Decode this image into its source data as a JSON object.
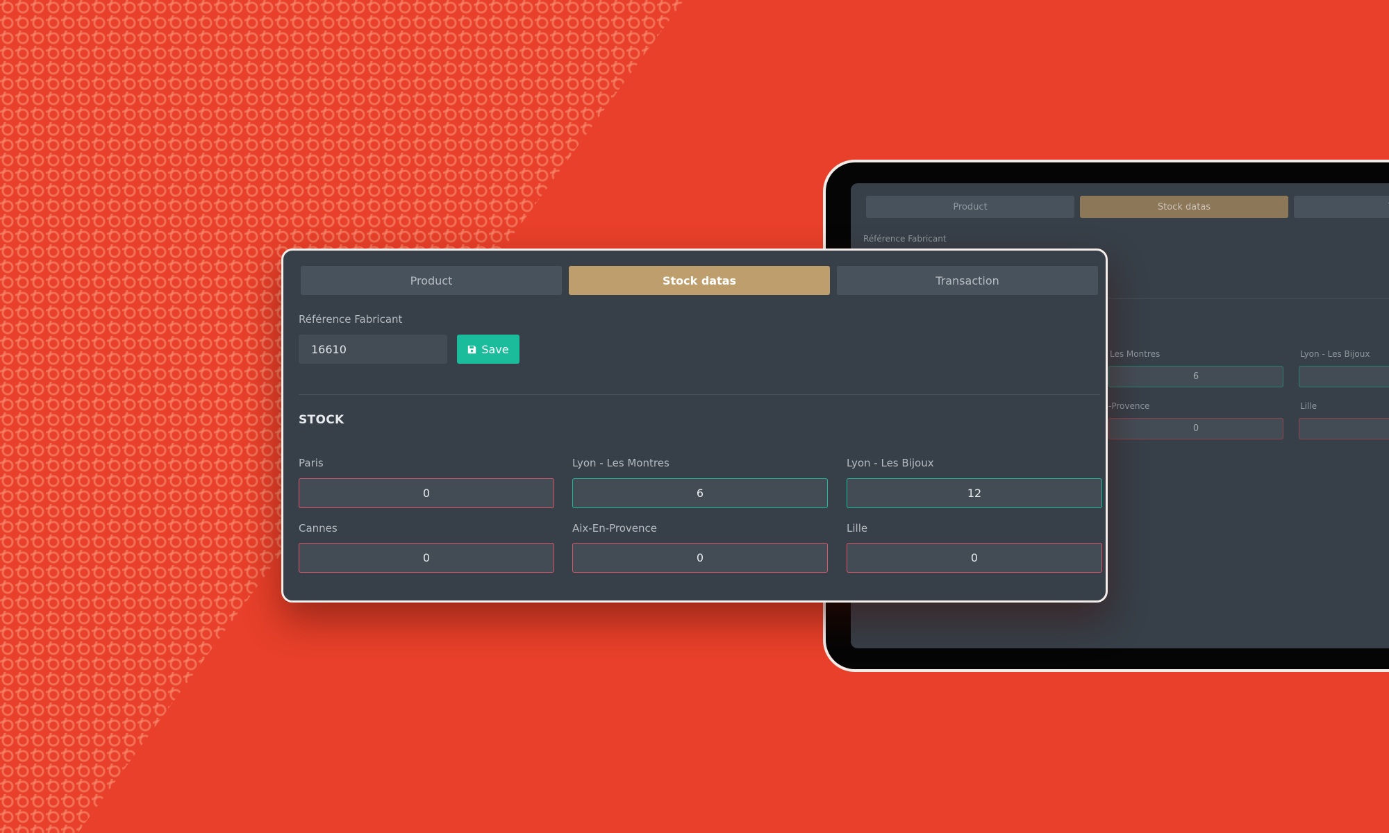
{
  "colors": {
    "background": "#e8402a",
    "panel": "#373f48",
    "tab": "#48525c",
    "tab_active": "#bd9e6c",
    "save_button": "#1abc9c",
    "border_zero": "#d9566b",
    "border_positive": "#1abc9c"
  },
  "tabs": [
    {
      "label": "Product",
      "active": false
    },
    {
      "label": "Stock datas",
      "active": true
    },
    {
      "label": "Transaction",
      "active": false
    }
  ],
  "reference": {
    "label": "Référence Fabricant",
    "value": "16610",
    "save_label": "Save",
    "save_icon": "floppy-disk-icon"
  },
  "stock": {
    "title": "STOCK",
    "locations": [
      {
        "name": "Paris",
        "quantity": "0"
      },
      {
        "name": "Lyon - Les Montres",
        "quantity": "6"
      },
      {
        "name": "Lyon - Les Bijoux",
        "quantity": "12"
      },
      {
        "name": "Cannes",
        "quantity": "0"
      },
      {
        "name": "Aix-En-Provence",
        "quantity": "0"
      },
      {
        "name": "Lille",
        "quantity": "0"
      }
    ]
  },
  "tablet": {
    "tabs": [
      "Product",
      "Stock datas",
      "Tran"
    ],
    "reference_label": "Référence Fabricant",
    "locations": [
      {
        "name": "Les Montres",
        "quantity": "6"
      },
      {
        "name": "Lyon - Les Bijoux",
        "quantity": ""
      },
      {
        "name": "-Provence",
        "quantity": "0"
      },
      {
        "name": "Lille",
        "quantity": ""
      }
    ]
  }
}
